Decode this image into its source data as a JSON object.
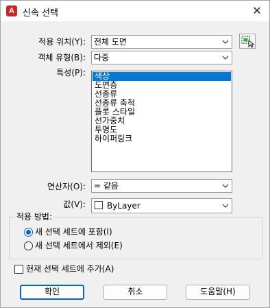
{
  "window": {
    "title": "신속 선택",
    "app_icon_letter": "A",
    "close_glyph": "✕"
  },
  "apply_to": {
    "label": "적용 위치(Y):",
    "value": "전체 도면"
  },
  "object_type": {
    "label": "객체 유형(B):",
    "value": "다중"
  },
  "properties": {
    "label": "특성(P):",
    "items": [
      "색상",
      "도면층",
      "선종류",
      "선종류 축척",
      "플롯 스타일",
      "선가중치",
      "투명도",
      "하이퍼링크"
    ],
    "selected_index": 0
  },
  "operator": {
    "label": "연산자(O):",
    "value": "= 같음"
  },
  "value": {
    "label": "값(V):",
    "value": "ByLayer"
  },
  "how_to_apply": {
    "title": "적용 방법:",
    "options": [
      "새 선택 세트에 포함(I)",
      "새 선택 세트에서 제외(E)"
    ],
    "selected_index": 0
  },
  "append": {
    "label": "현재 선택 세트에 추가(A)",
    "checked": false
  },
  "buttons": {
    "ok": "확인",
    "cancel": "취소",
    "help": "도움말(H)"
  },
  "colors": {
    "accent": "#0067c0",
    "selection": "#0078d7",
    "app_icon": "#c62828"
  }
}
